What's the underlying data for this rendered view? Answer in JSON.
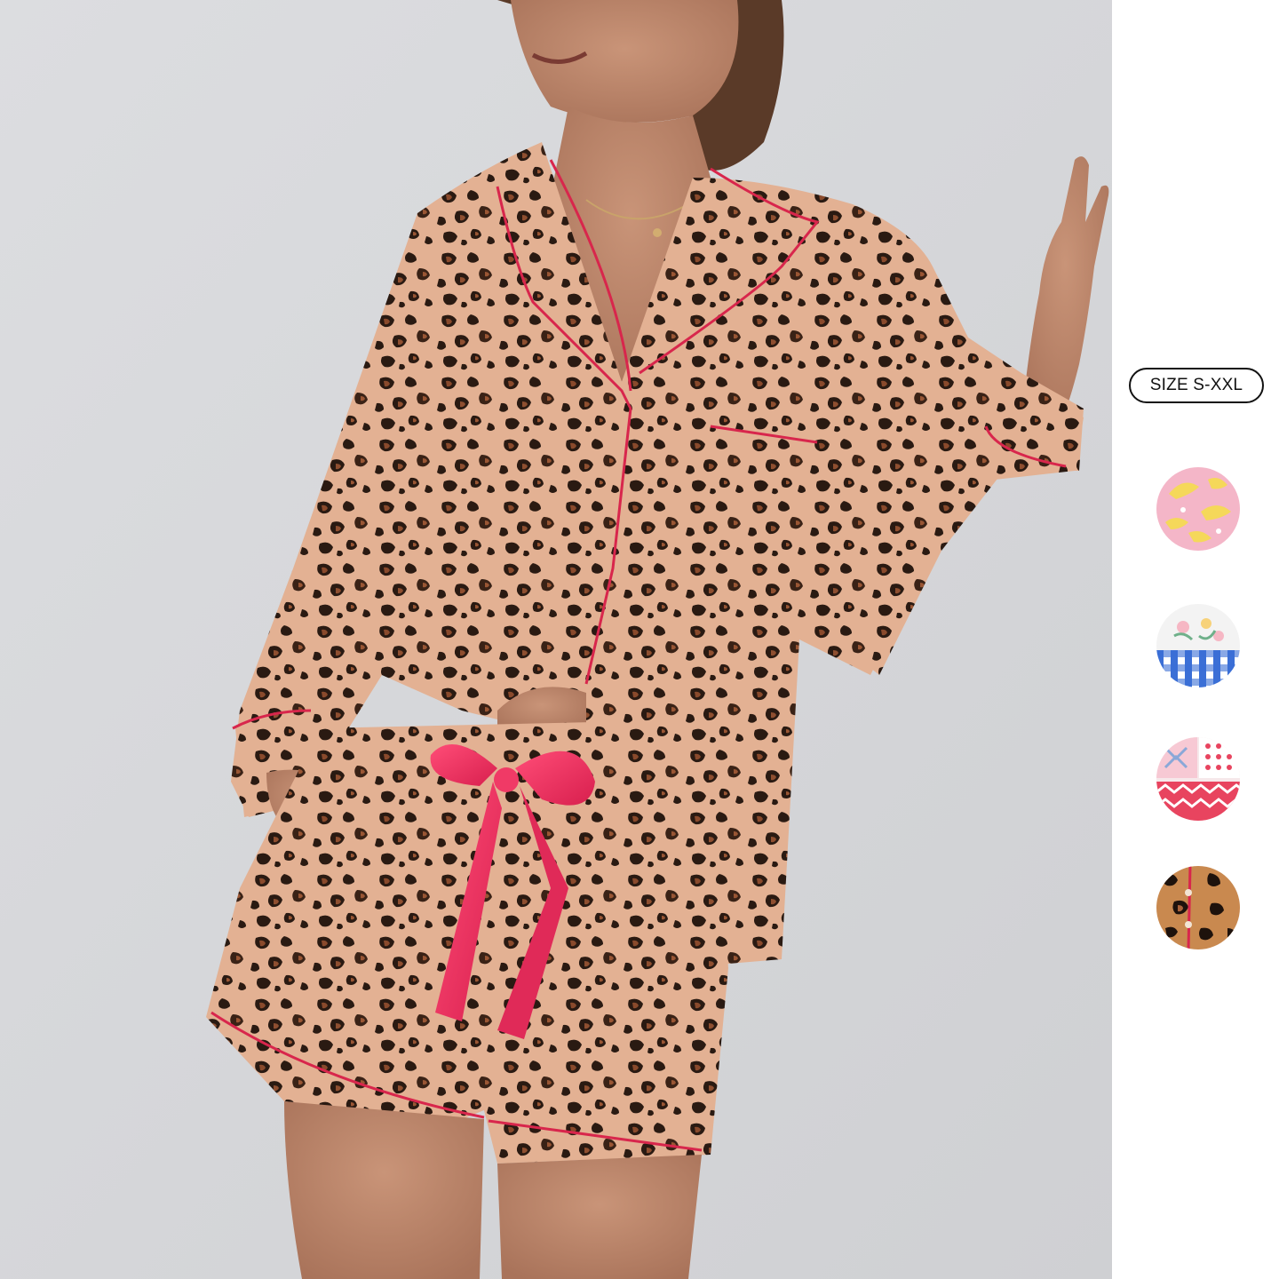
{
  "size_badge": {
    "label": "SIZE S-XXL"
  },
  "swatches": [
    {
      "name": "pink-banana-print",
      "base": "#f4b6c8"
    },
    {
      "name": "floral-gingham-print",
      "base": "#f3f3f3"
    },
    {
      "name": "pink-patchwork-print",
      "base": "#f6e8ea"
    },
    {
      "name": "leopard-print",
      "base": "#c9894f"
    }
  ],
  "colors": {
    "background": "#d8d9db",
    "leopard_base": "#e2b08f",
    "leopard_spot": "#2a1a12",
    "ribbon": "#ef2f5f",
    "piping": "#d8264c"
  }
}
